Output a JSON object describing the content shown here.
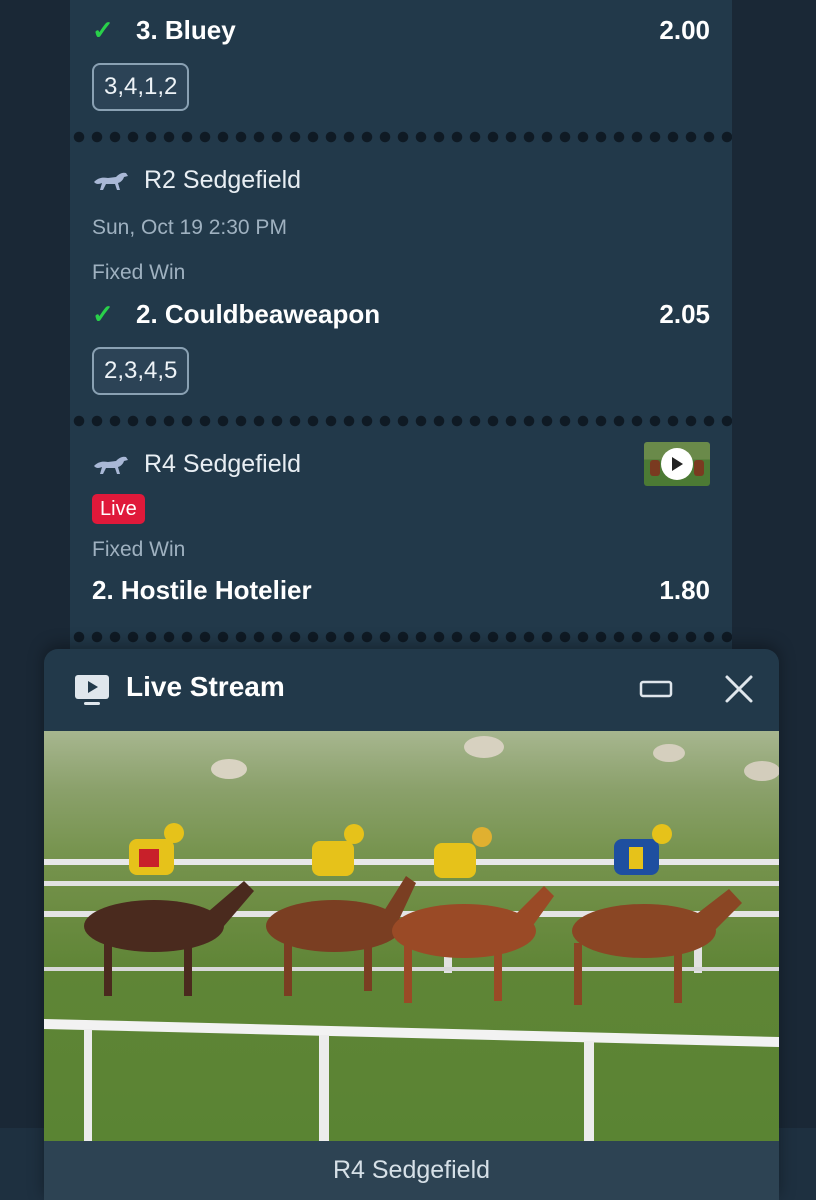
{
  "legs": [
    {
      "selection": "3. Bluey",
      "odds": "2.00",
      "combo": "3,4,1,2"
    },
    {
      "race": "R2 Sedgefield",
      "datetime": "Sun, Oct 19 2:30 PM",
      "market": "Fixed Win",
      "selection": "2. Couldbeaweapon",
      "odds": "2.05",
      "combo": "2,3,4,5"
    },
    {
      "race": "R4 Sedgefield",
      "status": "Live",
      "market": "Fixed Win",
      "selection": "2. Hostile Hotelier",
      "odds": "1.80"
    }
  ],
  "stream": {
    "title": "Live Stream",
    "footer_label": "R4 Sedgefield"
  },
  "icons": {
    "tick": "✓",
    "race_type": "horse-racing-icon",
    "stream": "tv-play-icon",
    "minimize": "minimize-icon",
    "close": "close-icon"
  },
  "colors": {
    "background": "#1b2a38",
    "card": "#22394a",
    "tick": "#29d04a",
    "live": "#e0193a"
  }
}
